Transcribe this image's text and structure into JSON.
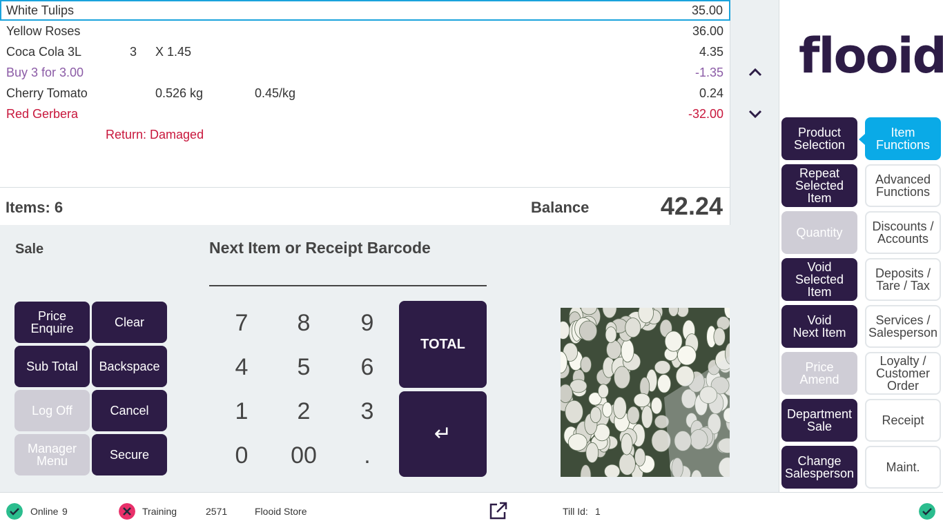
{
  "receipt": {
    "lines": [
      {
        "name": "White Tulips",
        "amount": "35.00"
      },
      {
        "name": "Yellow Roses",
        "amount": "36.00"
      },
      {
        "name": "Coca Cola 3L",
        "qty": "3",
        "price": "X 1.45",
        "amount": "4.35"
      },
      {
        "name": "Buy 3 for 3.00",
        "amount": "-1.35"
      },
      {
        "name": "Cherry Tomato",
        "weight": "0.526 kg",
        "unit_price": "0.45/kg",
        "amount": "0.24"
      },
      {
        "name": "Red Gerbera",
        "amount": "-32.00"
      }
    ],
    "return_reason": "Return: Damaged",
    "items_label": "Items: 6",
    "balance_label": "Balance",
    "balance_value": "42.24",
    "colors": {
      "selected_border": "#1aa3dc",
      "promo": "#8b5ba6",
      "return": "#c8173c"
    }
  },
  "logo": "flooid",
  "entry": {
    "mode": "Sale",
    "prompt": "Next Item or Receipt Barcode",
    "value": ""
  },
  "function_buttons": {
    "price_enquire": "Price\nEnquire",
    "clear": "Clear",
    "sub_total": "Sub Total",
    "backspace": "Backspace",
    "log_off": "Log Off",
    "cancel": "Cancel",
    "manager_menu": "Manager\nMenu",
    "secure": "Secure"
  },
  "keypad": {
    "keys": [
      "7",
      "8",
      "9",
      "4",
      "5",
      "6",
      "1",
      "2",
      "3",
      "0",
      "00",
      "."
    ],
    "total": "TOTAL",
    "enter": "↵"
  },
  "menu_left": {
    "product_selection": "Product\nSelection",
    "repeat_selected": "Repeat\nSelected\nItem",
    "quantity": "Quantity",
    "void_selected": "Void\nSelected\nItem",
    "void_next": "Void\nNext Item",
    "price_amend": "Price\nAmend",
    "department_sale": "Department\nSale",
    "change_salesperson": "Change\nSalesperson"
  },
  "menu_right": {
    "item_functions": "Item\nFunctions",
    "advanced_functions": "Advanced\nFunctions",
    "discounts_accounts": "Discounts /\nAccounts",
    "deposits_tare_tax": "Deposits /\nTare / Tax",
    "services_salesperson": "Services /\nSalesperson",
    "loyalty_customer_order": "Loyalty /\nCustomer\nOrder",
    "receipt": "Receipt",
    "maint": "Maint."
  },
  "status": {
    "online_label": "Online",
    "online_count": "9",
    "training_label": "Training",
    "store_number": "2571",
    "store_name": "Flooid Store",
    "till_label": "Till Id:",
    "till_id": "1",
    "icons": {
      "online": "check-circle-icon",
      "training": "x-circle-icon",
      "external": "open-external-icon",
      "connection": "check-circle-icon"
    },
    "colors": {
      "ok": "#2bbd8e",
      "error": "#e8306a"
    }
  },
  "theme": {
    "dark": "#2d1c46",
    "disabled": "#cfcdd6",
    "accent": "#0aaae7"
  }
}
